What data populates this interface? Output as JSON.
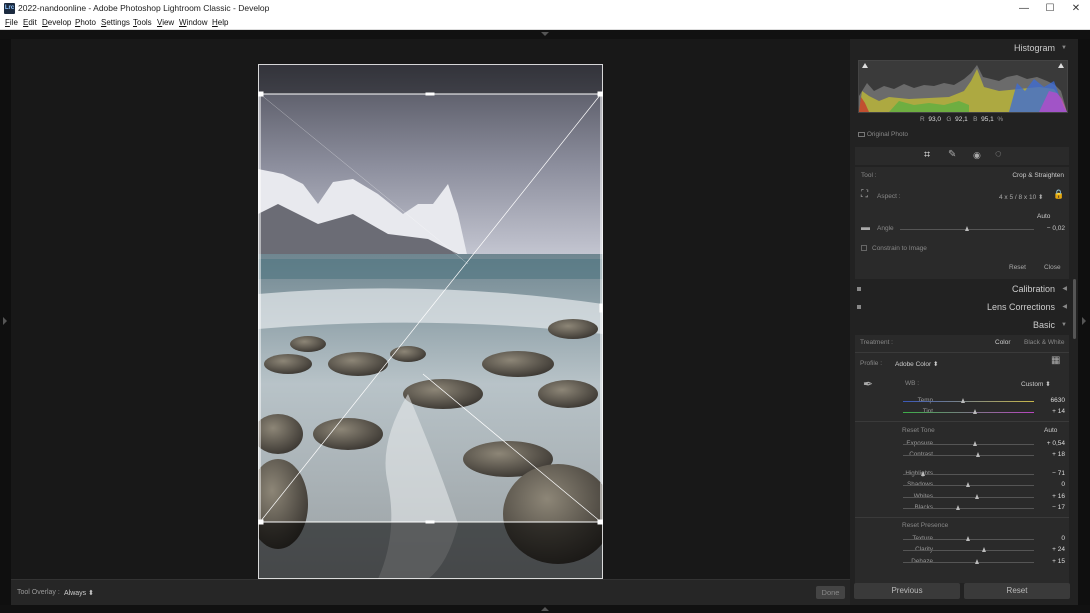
{
  "window": {
    "title": "2022-nandoonline - Adobe Photoshop Lightroom Classic - Develop",
    "app_icon": "Lrc",
    "minimize": "—",
    "maximize": "☐",
    "close": "✕"
  },
  "menu": [
    "File",
    "Edit",
    "Develop",
    "Photo",
    "Settings",
    "Tools",
    "View",
    "Window",
    "Help"
  ],
  "toolbar": {
    "overlay_label": "Tool Overlay :",
    "overlay_value": "Always ⬍",
    "done_label": "Done"
  },
  "histogram": {
    "header": "Histogram",
    "r_label": "R",
    "r_value": "93,0",
    "g_label": "G",
    "g_value": "92,1",
    "b_label": "B",
    "b_value": "95,1",
    "percent": "%",
    "original_photo": "Original Photo"
  },
  "crop": {
    "tool_label": "Tool :",
    "tool_name": "Crop & Straighten",
    "aspect_label": "Aspect :",
    "aspect_value": "4 x 5  /  8 x 10 ⬍",
    "auto_label": "Auto",
    "angle_label": "Angle",
    "angle_value": "− 0,02",
    "angle_level": 0.5,
    "constrain_label": "Constrain to Image",
    "reset_label": "Reset",
    "close_label": "Close"
  },
  "panels": {
    "calibration": "Calibration",
    "lens_corrections": "Lens Corrections",
    "basic": "Basic"
  },
  "basic": {
    "treatment_label": "Treatment :",
    "treatment_color": "Color",
    "treatment_bw": "Black & White",
    "profile_label": "Profile :",
    "profile_value": "Adobe Color ⬍",
    "wb_label": "WB :",
    "wb_value": "Custom ⬍",
    "tone_reset": "Reset Tone",
    "tone_auto": "Auto",
    "presence_reset": "Reset Presence",
    "sliders": [
      {
        "label": "Temp",
        "value": "6630",
        "level": 0.46
      },
      {
        "label": "Tint",
        "value": "+ 14",
        "level": 0.55
      },
      {
        "label": "Exposure",
        "value": "+ 0,54",
        "level": 0.55
      },
      {
        "label": "Contrast",
        "value": "+ 18",
        "level": 0.58
      },
      {
        "label": "Highlights",
        "value": "− 71",
        "level": 0.16
      },
      {
        "label": "Shadows",
        "value": "0",
        "level": 0.5
      },
      {
        "label": "Whites",
        "value": "+ 16",
        "level": 0.57
      },
      {
        "label": "Blacks",
        "value": "− 17",
        "level": 0.42
      },
      {
        "label": "Texture",
        "value": "0",
        "level": 0.5
      },
      {
        "label": "Clarity",
        "value": "+ 24",
        "level": 0.62
      },
      {
        "label": "Dehaze",
        "value": "+ 15",
        "level": 0.57
      }
    ]
  },
  "bottom": {
    "previous": "Previous",
    "reset": "Reset"
  },
  "colors": {
    "panel_bg": "#222222",
    "section_bg": "#2a2a2a",
    "canvas_bg": "#181818"
  }
}
